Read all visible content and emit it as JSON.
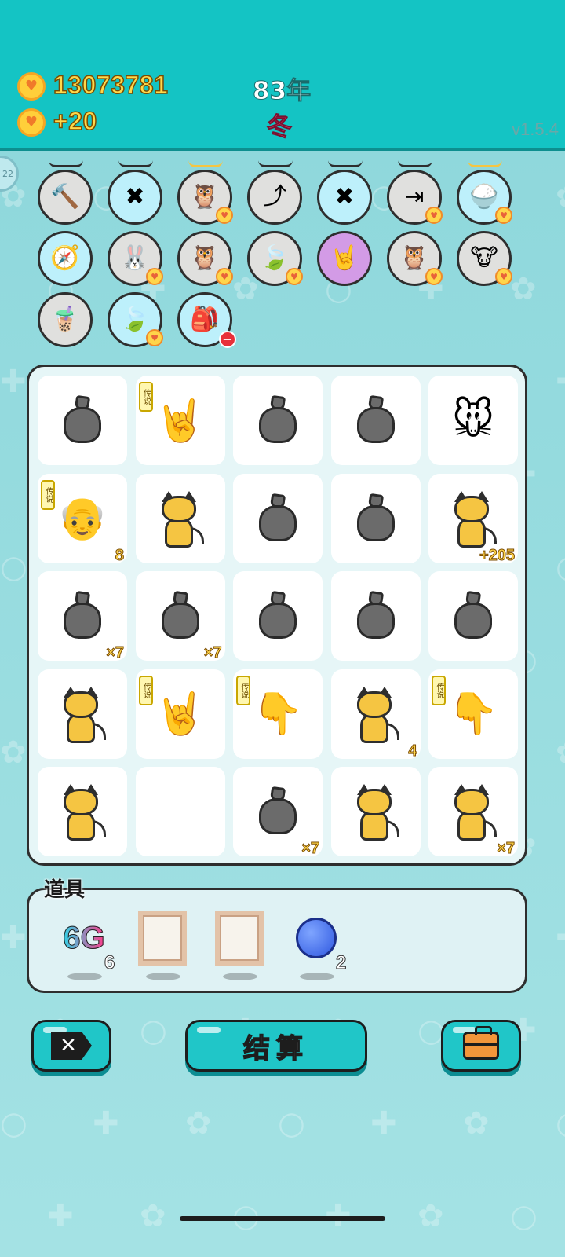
{
  "header": {
    "coins_total": "13073781",
    "coins_rate": "+20",
    "year": "83年",
    "season": "冬",
    "version": "v1.5.4",
    "side_label": "22"
  },
  "collection": [
    {
      "icon": "hammer-icon",
      "glyph": "🔨",
      "bg": "#e0e0de",
      "badge": ""
    },
    {
      "icon": "chopsticks-icon",
      "glyph": "✖",
      "bg": "#bdf0fb",
      "badge": ""
    },
    {
      "icon": "owl-pair-icon",
      "glyph": "🦉",
      "bg": "#e0e0de",
      "badge": "heart"
    },
    {
      "icon": "turn-arrow-icon",
      "glyph": "⤴",
      "bg": "#e0e0de",
      "badge": ""
    },
    {
      "icon": "chopsticks-icon",
      "glyph": "✖",
      "bg": "#bdf0fb",
      "badge": ""
    },
    {
      "icon": "skip-icon",
      "glyph": "⇥",
      "bg": "#e0e0de",
      "badge": "heart"
    },
    {
      "icon": "rice-bowl-icon",
      "glyph": "🍚",
      "bg": "#bdf0fb",
      "badge": "heart"
    },
    {
      "icon": "compass-icon",
      "glyph": "🧭",
      "bg": "#bdf0fb",
      "badge": ""
    },
    {
      "icon": "rabbit-icon",
      "glyph": "🐰",
      "bg": "#e0e0de",
      "badge": "heart"
    },
    {
      "icon": "owl-pair-icon",
      "glyph": "🦉",
      "bg": "#e0e0de",
      "badge": "heart"
    },
    {
      "icon": "leaf-icon",
      "glyph": "🍃",
      "bg": "#e0e0de",
      "badge": "heart"
    },
    {
      "icon": "rock-hand-icon",
      "glyph": "🤘",
      "bg": "#d39be6",
      "badge": ""
    },
    {
      "icon": "owl-pair-icon",
      "glyph": "🦉",
      "bg": "#e0e0de",
      "badge": "heart"
    },
    {
      "icon": "cow-pair-icon",
      "glyph": "🐮",
      "bg": "#e0e0de",
      "badge": "heart"
    },
    {
      "icon": "bubble-tea-icon",
      "glyph": "🧋",
      "bg": "#e0e0de",
      "badge": ""
    },
    {
      "icon": "leaf-icon",
      "glyph": "🍃",
      "bg": "#bdf0fb",
      "badge": "heart"
    },
    {
      "icon": "sack-icon",
      "glyph": "🎒",
      "bg": "#bdf0fb",
      "badge": "minus"
    }
  ],
  "board": [
    {
      "icon": "trash-bag-icon",
      "kind": "bag",
      "legend": "",
      "mult": ""
    },
    {
      "icon": "rock-hand-icon",
      "kind": "glyph",
      "glyph": "🤘",
      "legend": "传说",
      "mult": ""
    },
    {
      "icon": "trash-bag-icon",
      "kind": "bag",
      "legend": "",
      "mult": ""
    },
    {
      "icon": "trash-bag-icon",
      "kind": "bag",
      "legend": "",
      "mult": ""
    },
    {
      "icon": "mouse-icon",
      "kind": "glyph",
      "glyph": "🐭",
      "legend": "",
      "mult": ""
    },
    {
      "icon": "old-man-icon",
      "kind": "glyph",
      "glyph": "👴",
      "legend": "传说",
      "mult": "8"
    },
    {
      "icon": "cat-icon",
      "kind": "cat",
      "legend": "",
      "mult": ""
    },
    {
      "icon": "trash-bag-icon",
      "kind": "bag",
      "legend": "",
      "mult": ""
    },
    {
      "icon": "trash-bag-icon",
      "kind": "bag",
      "legend": "",
      "mult": ""
    },
    {
      "icon": "cat-icon",
      "kind": "cat",
      "legend": "",
      "mult": "+205"
    },
    {
      "icon": "trash-bag-icon",
      "kind": "bag",
      "legend": "",
      "mult": "×7"
    },
    {
      "icon": "trash-bag-icon",
      "kind": "bag",
      "legend": "",
      "mult": "×7"
    },
    {
      "icon": "trash-bag-icon",
      "kind": "bag",
      "legend": "",
      "mult": ""
    },
    {
      "icon": "trash-bag-icon",
      "kind": "bag",
      "legend": "",
      "mult": ""
    },
    {
      "icon": "trash-bag-icon",
      "kind": "bag",
      "legend": "",
      "mult": ""
    },
    {
      "icon": "cat-icon",
      "kind": "cat",
      "legend": "",
      "mult": ""
    },
    {
      "icon": "rock-hand-icon",
      "kind": "glyph",
      "glyph": "🤘",
      "legend": "传说",
      "mult": ""
    },
    {
      "icon": "pointing-hand-icon",
      "kind": "glyph",
      "glyph": "👇",
      "legend": "传说",
      "mult": ""
    },
    {
      "icon": "cat-icon",
      "kind": "cat",
      "legend": "",
      "mult": "4"
    },
    {
      "icon": "pointing-hand-icon",
      "kind": "glyph",
      "glyph": "👇",
      "legend": "传说",
      "mult": ""
    },
    {
      "icon": "cat-icon",
      "kind": "cat",
      "legend": "",
      "mult": ""
    },
    {
      "icon": "empty-slot",
      "kind": "empty",
      "legend": "",
      "mult": ""
    },
    {
      "icon": "trash-bag-icon",
      "kind": "bag",
      "legend": "",
      "mult": "×7"
    },
    {
      "icon": "cat-icon",
      "kind": "cat",
      "legend": "",
      "mult": ""
    },
    {
      "icon": "cat-icon",
      "kind": "cat",
      "legend": "",
      "mult": "×7"
    }
  ],
  "props": {
    "title": "道具",
    "items": [
      {
        "icon": "6g-icon",
        "label": "6G",
        "count": "6"
      },
      {
        "icon": "picture-frame-icon",
        "label": "",
        "count": ""
      },
      {
        "icon": "picture-frame-icon",
        "label": "",
        "count": ""
      },
      {
        "icon": "blueberry-icon",
        "label": "",
        "count": "2"
      }
    ]
  },
  "buttons": {
    "settle_label": "结算"
  }
}
